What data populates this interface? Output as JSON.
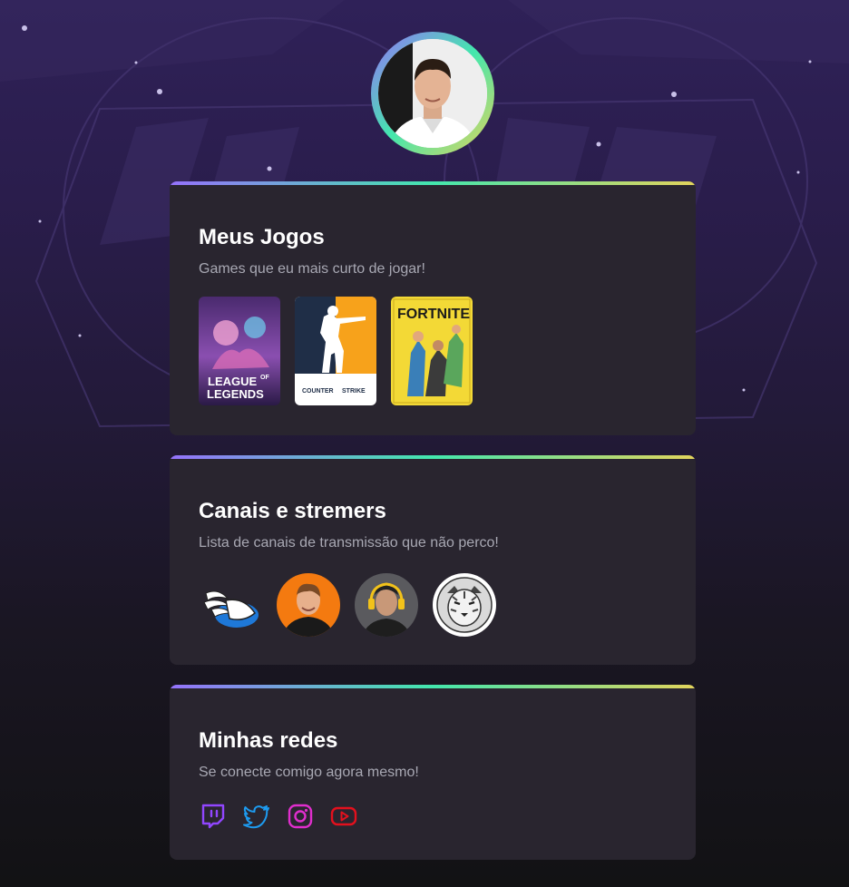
{
  "profile": {
    "avatar_icon": "profile-photo"
  },
  "games_card": {
    "title": "Meus Jogos",
    "subtitle": "Games que eu mais curto de jogar!",
    "games": [
      {
        "name": "LEAGUE OF LEGENDS",
        "line1": "LEAGUE",
        "of": "OF",
        "line2": "LEGENDS"
      },
      {
        "name": "COUNTER STRIKE",
        "line1": "COUNTER",
        "line2": "STRIKE"
      },
      {
        "name": "FORTNITE",
        "line1": "FORTNITE"
      }
    ]
  },
  "channels_card": {
    "title": "Canais e stremers",
    "subtitle": "Lista de canais de transmissão que não perco!",
    "channels": [
      {
        "icon": "winged-shoe-logo"
      },
      {
        "icon": "streamer-avatar-orange"
      },
      {
        "icon": "streamer-avatar-headset"
      },
      {
        "icon": "tiger-logo"
      }
    ]
  },
  "socials_card": {
    "title": "Minhas redes",
    "subtitle": "Se conecte comigo agora mesmo!",
    "links": [
      {
        "icon": "twitch-icon",
        "color": "#9146ff"
      },
      {
        "icon": "twitter-icon",
        "color": "#1d9bf0"
      },
      {
        "icon": "instagram-icon",
        "color": "#e02ecd"
      },
      {
        "icon": "youtube-icon",
        "color": "#e3101d"
      }
    ]
  },
  "colors": {
    "gradient_start": "#9572fc",
    "gradient_mid": "#43e7ad",
    "gradient_end": "#e2d45c",
    "card_bg": "#29252f",
    "subtitle_text": "#a8a8b3"
  }
}
